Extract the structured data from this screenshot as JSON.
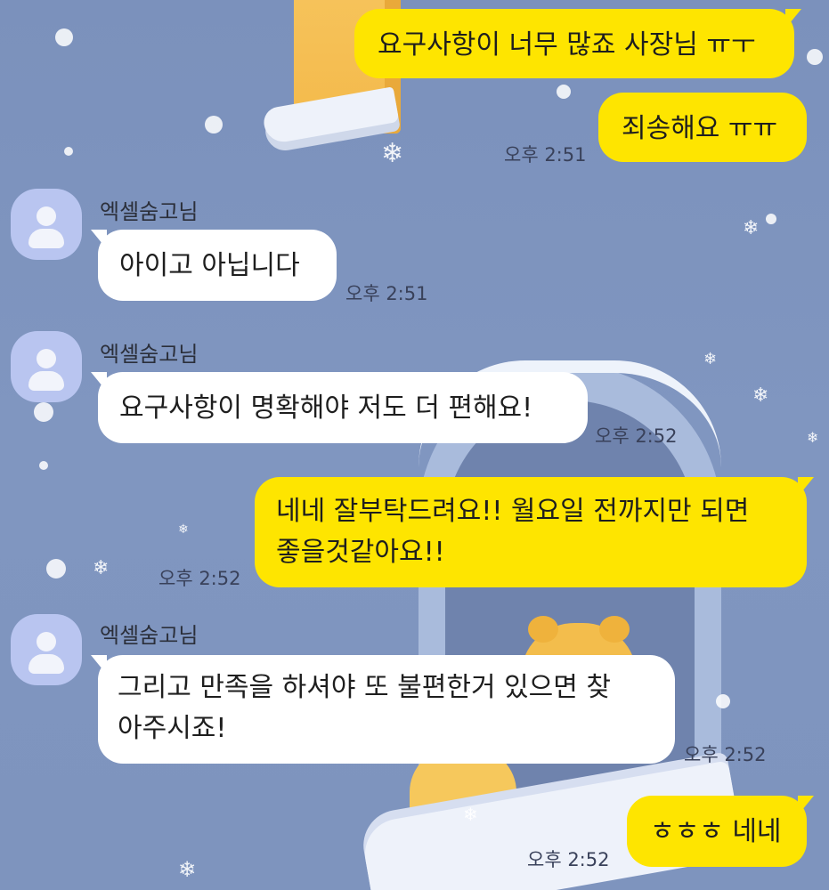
{
  "chat": {
    "messages": [
      {
        "type": "sent",
        "text": "요구사항이 너무 많죠 사장님 ㅠㅜ"
      },
      {
        "type": "sent",
        "text": "죄송해요 ㅠㅠ",
        "time": "오후 2:51"
      },
      {
        "type": "received",
        "sender": "엑셀숨고님",
        "text": "아이고 아닙니다",
        "time": "오후 2:51"
      },
      {
        "type": "received",
        "sender": "엑셀숨고님",
        "text": "요구사항이 명확해야 저도 더 편해요!",
        "time": "오후 2:52"
      },
      {
        "type": "sent",
        "lines": [
          "네네 잘부탁드려요!! 월요일 전까지만 되면",
          "좋을것같아요!!"
        ],
        "time": "오후 2:52"
      },
      {
        "type": "received",
        "sender": "엑셀숨고님",
        "lines": [
          "그리고 만족을 하셔야 또 불편한거 있으면 찾",
          "아주시죠!"
        ],
        "time": "오후 2:52"
      },
      {
        "type": "sent",
        "text": "ㅎㅎㅎ 네네",
        "time": "오후 2:52"
      }
    ]
  },
  "colors": {
    "background": "#7d93bd",
    "sent_bubble": "#fee500",
    "received_bubble": "#ffffff",
    "avatar": "#b9c5f0"
  },
  "icons": {
    "avatar": "default-profile-icon"
  }
}
